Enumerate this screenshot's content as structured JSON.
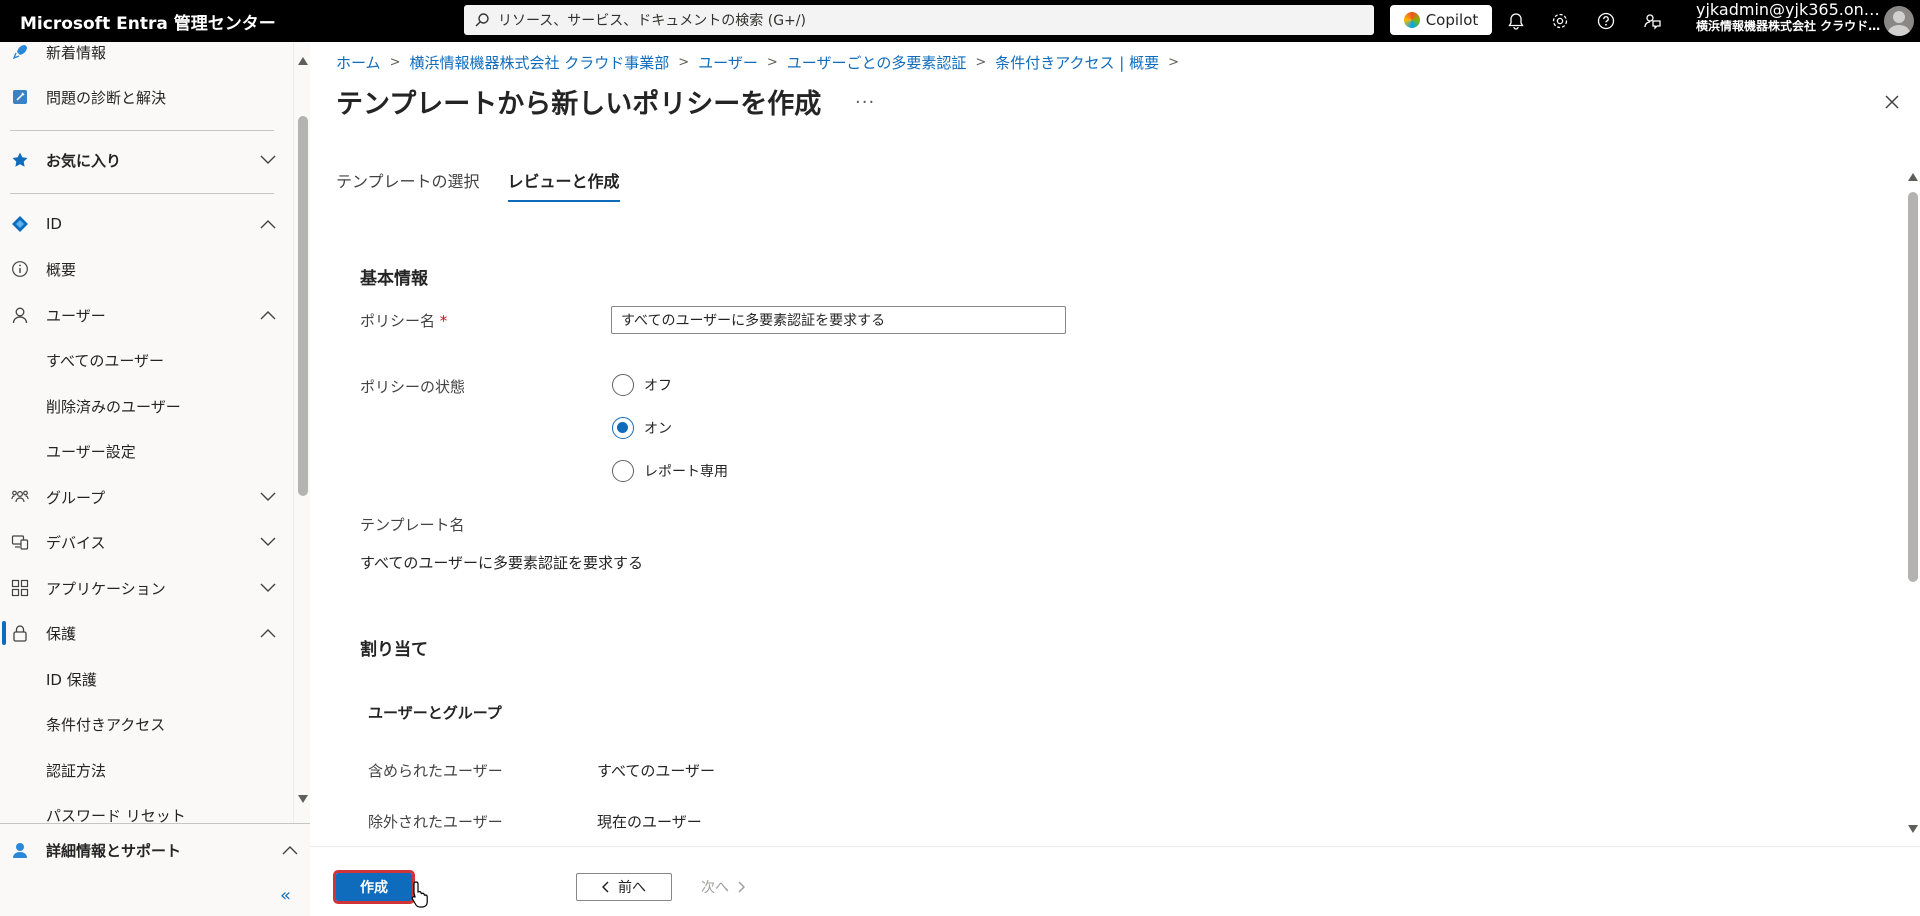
{
  "topbar": {
    "brand": "Microsoft Entra 管理センター",
    "search_placeholder": "リソース、サービス、ドキュメントの検索 (G+/)",
    "copilot_label": "Copilot",
    "account_email": "yjkadmin@yjk365.on…",
    "account_org": "横浜情報機器株式会社 クラウド…"
  },
  "sidebar": {
    "items": [
      {
        "label": "新着情報"
      },
      {
        "label": "問題の診断と解決"
      },
      {
        "label": "お気に入り"
      },
      {
        "label": "ID"
      },
      {
        "label": "概要"
      },
      {
        "label": "ユーザー"
      },
      {
        "label": "すべてのユーザー"
      },
      {
        "label": "削除済みのユーザー"
      },
      {
        "label": "ユーザー設定"
      },
      {
        "label": "グループ"
      },
      {
        "label": "デバイス"
      },
      {
        "label": "アプリケーション"
      },
      {
        "label": "保護"
      },
      {
        "label": "ID 保護"
      },
      {
        "label": "条件付きアクセス"
      },
      {
        "label": "認証方法"
      },
      {
        "label": "パスワード リセット"
      }
    ],
    "bottom_label": "詳細情報とサポート",
    "collapse_glyph": "«"
  },
  "breadcrumb": [
    "ホーム",
    "横浜情報機器株式会社 クラウド事業部",
    "ユーザー",
    "ユーザーごとの多要素認証",
    "条件付きアクセス | 概要"
  ],
  "page": {
    "title": "テンプレートから新しいポリシーを作成",
    "more": "···"
  },
  "tabs": [
    {
      "label": "テンプレートの選択",
      "selected": false
    },
    {
      "label": "レビューと作成",
      "selected": true
    }
  ],
  "basics": {
    "section_title": "基本情報",
    "policy_name_label": "ポリシー名",
    "required_mark": "*",
    "policy_name_value": "すべてのユーザーに多要素認証を要求する",
    "policy_state_label": "ポリシーの状態",
    "state_options": [
      "オフ",
      "オン",
      "レポート専用"
    ],
    "state_selected": "オン",
    "template_name_label": "テンプレート名",
    "template_name_value": "すべてのユーザーに多要素認証を要求する"
  },
  "assignments": {
    "section_title": "割り当て",
    "users_groups_title": "ユーザーとグループ",
    "included_label": "含められたユーザー",
    "included_value": "すべてのユーザー",
    "excluded_label": "除外されたユーザー",
    "excluded_value": "現在のユーザー"
  },
  "footer": {
    "create_label": "作成",
    "prev_label": "前へ",
    "next_label": "次へ"
  }
}
